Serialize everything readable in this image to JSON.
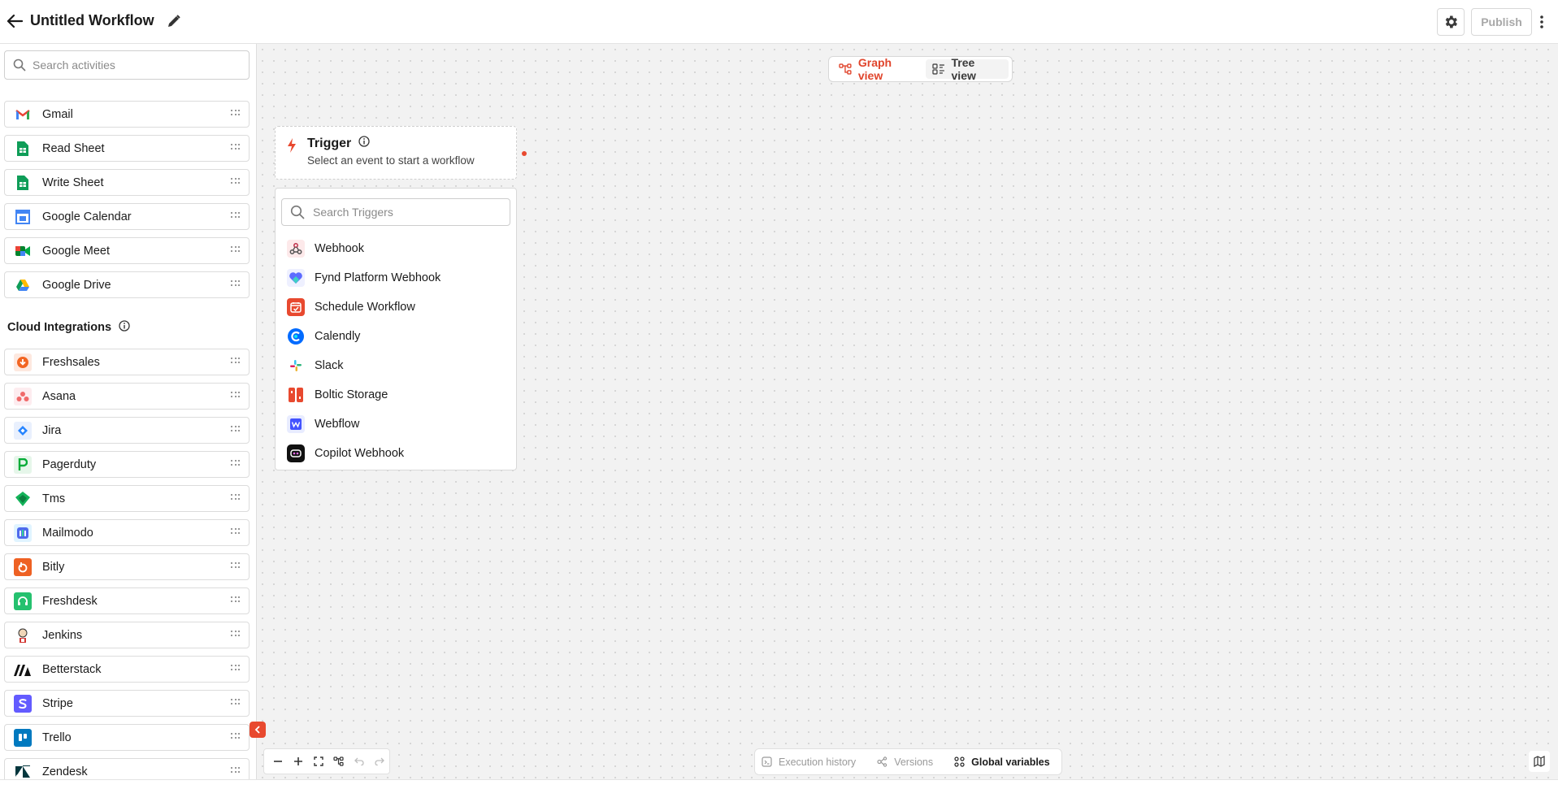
{
  "header": {
    "title": "Untitled Workflow",
    "publish_label": "Publish"
  },
  "sidebar": {
    "search_placeholder": "Search activities",
    "activities": [
      {
        "label": "Gmail",
        "icon": "gmail-icon"
      },
      {
        "label": "Read Sheet",
        "icon": "google-sheets-icon"
      },
      {
        "label": "Write Sheet",
        "icon": "google-sheets-icon"
      },
      {
        "label": "Google Calendar",
        "icon": "google-calendar-icon"
      },
      {
        "label": "Google Meet",
        "icon": "google-meet-icon"
      },
      {
        "label": "Google Drive",
        "icon": "google-drive-icon"
      }
    ],
    "cloud_heading": "Cloud Integrations",
    "integrations": [
      {
        "label": "Freshsales",
        "icon": "freshsales-icon"
      },
      {
        "label": "Asana",
        "icon": "asana-icon"
      },
      {
        "label": "Jira",
        "icon": "jira-icon"
      },
      {
        "label": "Pagerduty",
        "icon": "pagerduty-icon"
      },
      {
        "label": "Tms",
        "icon": "tms-icon"
      },
      {
        "label": "Mailmodo",
        "icon": "mailmodo-icon"
      },
      {
        "label": "Bitly",
        "icon": "bitly-icon"
      },
      {
        "label": "Freshdesk",
        "icon": "freshdesk-icon"
      },
      {
        "label": "Jenkins",
        "icon": "jenkins-icon"
      },
      {
        "label": "Betterstack",
        "icon": "betterstack-icon"
      },
      {
        "label": "Stripe",
        "icon": "stripe-icon"
      },
      {
        "label": "Trello",
        "icon": "trello-icon"
      },
      {
        "label": "Zendesk",
        "icon": "zendesk-icon"
      }
    ]
  },
  "canvas": {
    "view_toggle": {
      "graph_label": "Graph view",
      "tree_label": "Tree view",
      "active": "Graph view"
    },
    "trigger": {
      "title": "Trigger",
      "subtitle": "Select an event to start a workflow"
    },
    "trigger_panel": {
      "search_placeholder": "Search Triggers",
      "items": [
        {
          "label": "Webhook",
          "icon": "webhook-icon"
        },
        {
          "label": "Fynd Platform Webhook",
          "icon": "fynd-platform-icon"
        },
        {
          "label": "Schedule Workflow",
          "icon": "schedule-calendar-icon"
        },
        {
          "label": "Calendly",
          "icon": "calendly-icon"
        },
        {
          "label": "Slack",
          "icon": "slack-icon"
        },
        {
          "label": "Boltic Storage",
          "icon": "boltic-storage-icon"
        },
        {
          "label": "Webflow",
          "icon": "webflow-icon"
        },
        {
          "label": "Copilot Webhook",
          "icon": "copilot-webhook-icon"
        }
      ]
    },
    "bottom_bar": {
      "execution_history": "Execution history",
      "versions": "Versions",
      "global_variables": "Global variables"
    }
  },
  "colors": {
    "accent": "#e0452c",
    "canvas_bg": "#f2f2f2"
  }
}
